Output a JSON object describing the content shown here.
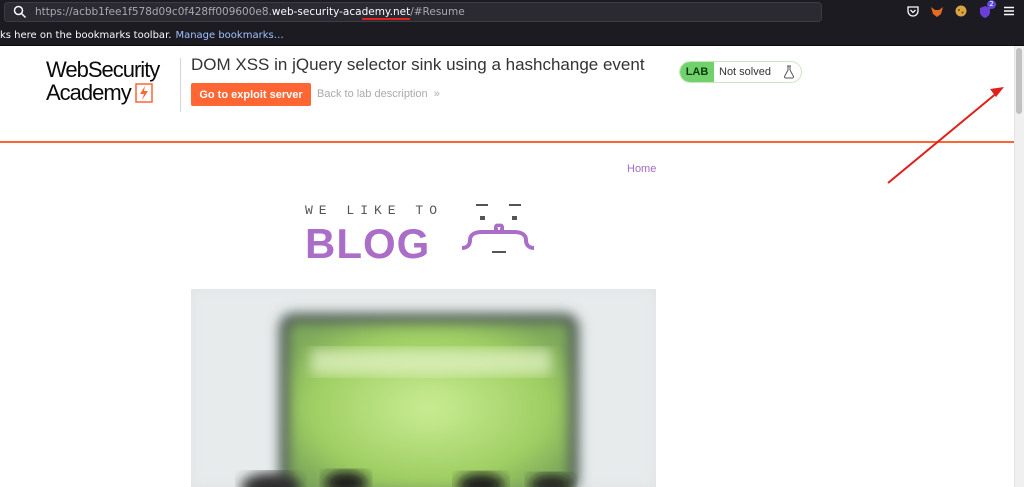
{
  "browser": {
    "url_prefix": "https://acbb1fee1f578d09c0f428ff009600e8.",
    "url_domain": "web-security-academy.net",
    "url_suffix": "/#Resume",
    "bookmarks_text": "ks here on the bookmarks toolbar.",
    "bookmarks_link": "Manage bookmarks…",
    "extension_badge": "2"
  },
  "lab": {
    "logo_line1": "WebSecurity",
    "logo_line2": "Academy",
    "title": "DOM XSS in jQuery selector sink using a hashchange event",
    "exploit_button": "Go to exploit server",
    "back_link": "Back to lab description",
    "back_chevron": "»",
    "status_badge": "LAB",
    "status_text": "Not solved"
  },
  "site": {
    "home_link": "Home",
    "blog_tagline": "WE LIKE TO",
    "blog_word": "BLOG"
  },
  "colors": {
    "accent": "#ff6633",
    "status_green": "#70d16d",
    "blog_purple": "#aa6dc8",
    "annotation_red": "#e0201b"
  }
}
